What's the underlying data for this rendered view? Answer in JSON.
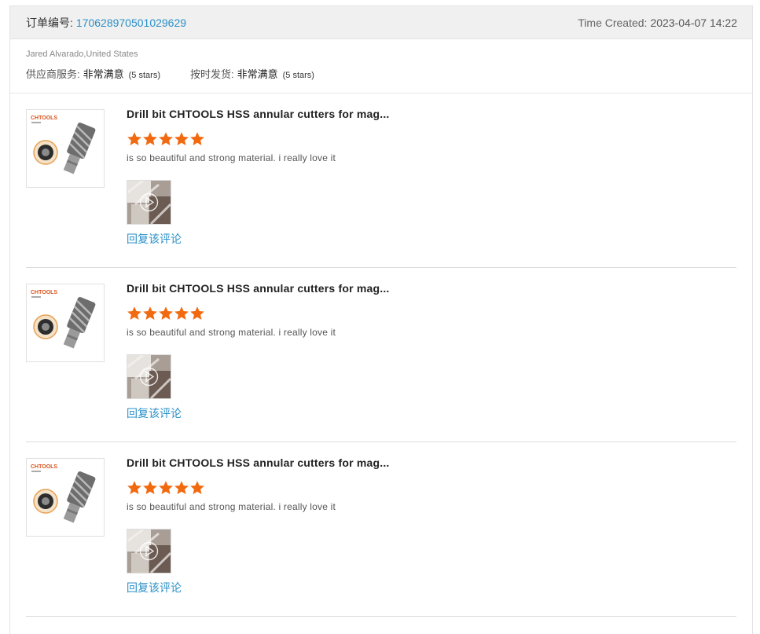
{
  "order": {
    "label": "订单编号:",
    "number": "170628970501029629",
    "time_label": "Time Created:",
    "time_value": "2023-04-07 14:22"
  },
  "buyer": {
    "name_location": "Jared Alvarado,United States",
    "supplier_service": {
      "label": "供应商服务:",
      "value": "非常满意",
      "stars": "(5 stars)"
    },
    "on_time_shipping": {
      "label": "按时发货:",
      "value": "非常满意",
      "stars": "(5 stars)"
    }
  },
  "colors": {
    "accent": "#2a8fc7",
    "star": "#f26a10",
    "header_bg": "#f0f0f0"
  },
  "thumbnail_brand": "CHTOOLS",
  "reviews": [
    {
      "title": "Drill bit CHTOOLS HSS annular cutters for mag...",
      "rating": 5,
      "comment": "is so beautiful and strong material. i really love it",
      "reply_label": "回复该评论",
      "media_icon": "play-video-icon"
    },
    {
      "title": "Drill bit CHTOOLS HSS annular cutters for mag...",
      "rating": 5,
      "comment": "is so beautiful and strong material. i really love it",
      "reply_label": "回复该评论",
      "media_icon": "play-video-icon"
    },
    {
      "title": "Drill bit CHTOOLS HSS annular cutters for mag...",
      "rating": 5,
      "comment": "is so beautiful and strong material. i really love it",
      "reply_label": "回复该评论",
      "media_icon": "play-video-icon"
    }
  ]
}
